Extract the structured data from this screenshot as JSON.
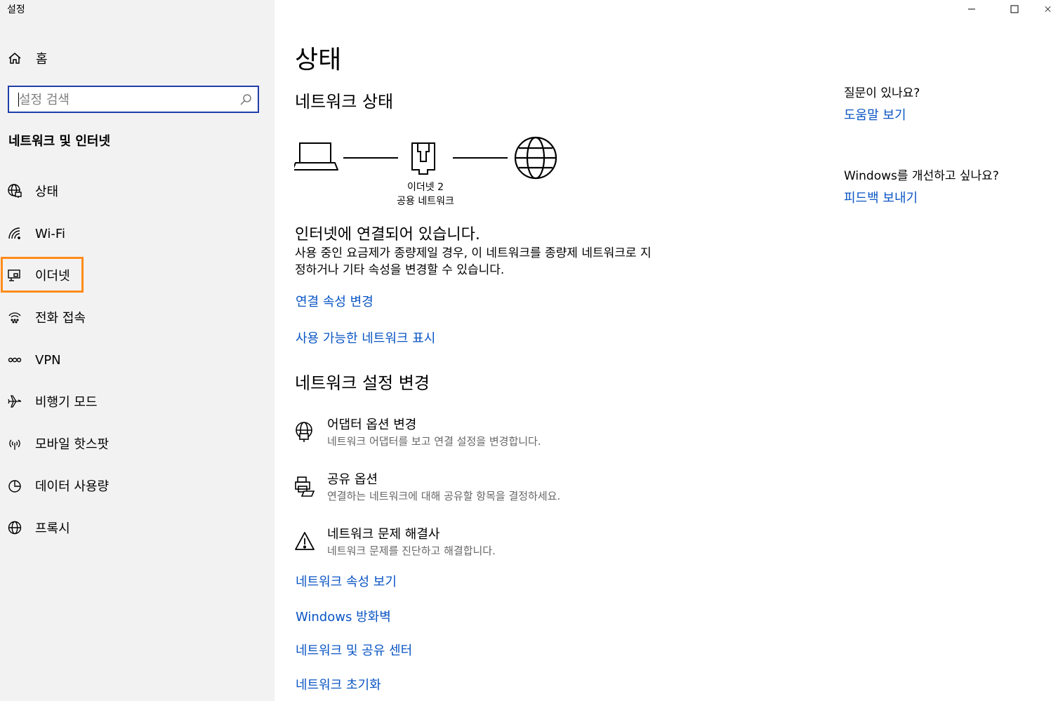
{
  "window": {
    "title": "설정",
    "minimize_label": "–",
    "maximize_label": "□",
    "close_label": "✕"
  },
  "sidebar": {
    "home_label": "홈",
    "search_placeholder": "설정 검색",
    "section_title": "네트워크 및 인터넷",
    "items": [
      {
        "label": "상태",
        "icon": "globe-network-icon"
      },
      {
        "label": "Wi-Fi",
        "icon": "wifi-icon"
      },
      {
        "label": "이더넷",
        "icon": "ethernet-icon"
      },
      {
        "label": "전화 접속",
        "icon": "dial-up-icon"
      },
      {
        "label": "VPN",
        "icon": "vpn-icon"
      },
      {
        "label": "비행기 모드",
        "icon": "airplane-icon"
      },
      {
        "label": "모바일 핫스팟",
        "icon": "hotspot-icon"
      },
      {
        "label": "데이터 사용량",
        "icon": "data-usage-icon"
      },
      {
        "label": "프록시",
        "icon": "proxy-icon"
      }
    ],
    "selected_index": 2
  },
  "main": {
    "title": "상태",
    "network_status_heading": "네트워크 상태",
    "diagram": {
      "adapter_name": "이더넷 2",
      "network_type": "공용 네트워크"
    },
    "connected_text": "인터넷에 연결되어 있습니다.",
    "description": "사용 중인 요금제가 종량제일 경우, 이 네트워크를 종량제 네트워크로 지정하거나 기타 속성을 변경할 수 있습니다.",
    "change_props_link": "연결 속성 변경",
    "show_networks_link": "사용 가능한 네트워크 표시",
    "change_settings_heading": "네트워크 설정 변경",
    "options": [
      {
        "title": "어댑터 옵션 변경",
        "subtitle": "네트워크 어댑터를 보고 연결 설정을 변경합니다."
      },
      {
        "title": "공유 옵션",
        "subtitle": "연결하는 네트워크에 대해 공유할 항목을 결정하세요."
      },
      {
        "title": "네트워크 문제 해결사",
        "subtitle": "네트워크 문제를 진단하고 해결합니다."
      }
    ],
    "bottom_links": [
      "네트워크 속성 보기",
      "Windows 방화벽",
      "네트워크 및 공유 센터",
      "네트워크 초기화"
    ]
  },
  "aside": {
    "question": "질문이 있나요?",
    "help_link": "도움말 보기",
    "improve_question": "Windows를 개선하고 싶나요?",
    "feedback_link": "피드백 보내기"
  },
  "colors": {
    "accent_link": "#0a55c4",
    "search_border": "#1f3ea8",
    "highlight_box": "#ff8c1a",
    "sidebar_bg": "#f2f2f2"
  }
}
